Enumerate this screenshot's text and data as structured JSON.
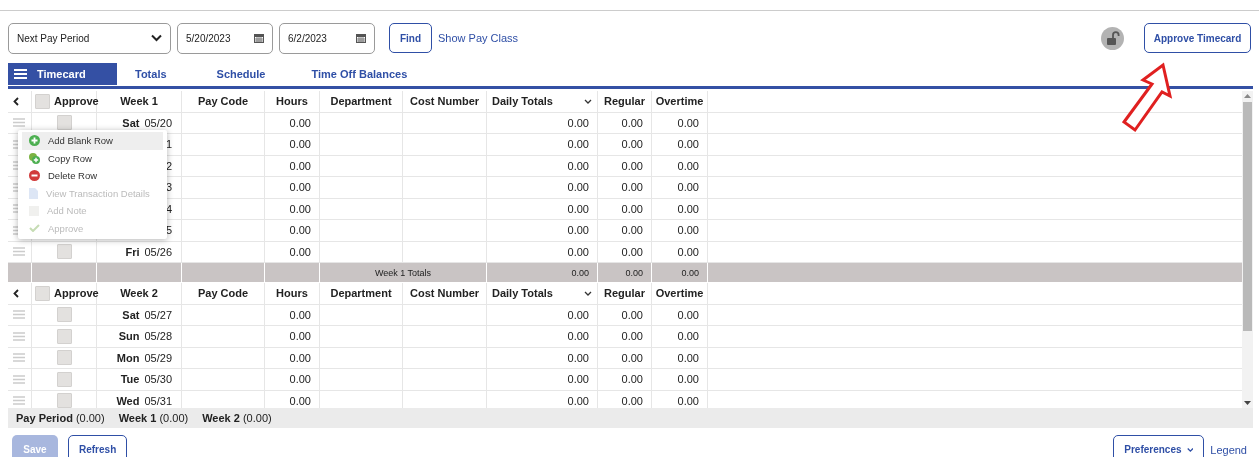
{
  "toolbar": {
    "period_select": "Next Pay Period",
    "start_date": "5/20/2023",
    "end_date": "6/2/2023",
    "find_button": "Find",
    "pay_class_link": "Show Pay Class",
    "locked": false,
    "approve_button": "Approve Timecard"
  },
  "tabs": [
    {
      "label": "Timecard",
      "selected": true
    },
    {
      "label": "Totals",
      "selected": false
    },
    {
      "label": "Schedule",
      "selected": false
    },
    {
      "label": "Time Off Balances",
      "selected": false
    }
  ],
  "weeks": [
    {
      "all_approved": false,
      "columns": [
        "Approve",
        "Week 1",
        "Pay Code",
        "Hours",
        "Department",
        "Cost Number",
        "Daily Totals",
        "Regular",
        "Overtime"
      ],
      "rows": [
        {
          "approved": false,
          "day": "Sat",
          "date": "05/20",
          "hours": "0.00",
          "daily_total": "0.00",
          "regular": "0.00",
          "overtime": "0.00"
        },
        {
          "date": "1",
          "hours": "0.00",
          "daily_total": "0.00",
          "regular": "0.00",
          "overtime": "0.00"
        },
        {
          "date": "2",
          "hours": "0.00",
          "daily_total": "0.00",
          "regular": "0.00",
          "overtime": "0.00"
        },
        {
          "date": "3",
          "hours": "0.00",
          "daily_total": "0.00",
          "regular": "0.00",
          "overtime": "0.00"
        },
        {
          "date": "4",
          "hours": "0.00",
          "daily_total": "0.00",
          "regular": "0.00",
          "overtime": "0.00"
        },
        {
          "date": "5",
          "hours": "0.00",
          "daily_total": "0.00",
          "regular": "0.00",
          "overtime": "0.00"
        },
        {
          "approved": false,
          "day": "Fri",
          "date": "05/26",
          "hours": "0.00",
          "daily_total": "0.00",
          "regular": "0.00",
          "overtime": "0.00"
        }
      ],
      "totals": {
        "label": "Week 1 Totals",
        "daily_total": "0.00",
        "regular": "0.00",
        "overtime": "0.00"
      }
    },
    {
      "all_approved": false,
      "columns": [
        "Approve",
        "Week 2",
        "Pay Code",
        "Hours",
        "Department",
        "Cost Number",
        "Daily Totals",
        "Regular",
        "Overtime"
      ],
      "rows": [
        {
          "approved": false,
          "day": "Sat",
          "date": "05/27",
          "hours": "0.00",
          "daily_total": "0.00",
          "regular": "0.00",
          "overtime": "0.00"
        },
        {
          "approved": false,
          "day": "Sun",
          "date": "05/28",
          "hours": "0.00",
          "daily_total": "0.00",
          "regular": "0.00",
          "overtime": "0.00"
        },
        {
          "approved": false,
          "day": "Mon",
          "date": "05/29",
          "hours": "0.00",
          "daily_total": "0.00",
          "regular": "0.00",
          "overtime": "0.00"
        },
        {
          "approved": false,
          "day": "Tue",
          "date": "05/30",
          "hours": "0.00",
          "daily_total": "0.00",
          "regular": "0.00",
          "overtime": "0.00"
        },
        {
          "approved": false,
          "day": "Wed",
          "date": "05/31",
          "hours": "0.00",
          "daily_total": "0.00",
          "regular": "0.00",
          "overtime": "0.00"
        }
      ]
    }
  ],
  "context_menu": [
    {
      "kind": "add",
      "label": "Add Blank Row",
      "disabled": false,
      "selected": true
    },
    {
      "kind": "copy",
      "label": "Copy Row",
      "disabled": false,
      "selected": false
    },
    {
      "kind": "delete",
      "label": "Delete Row",
      "disabled": false,
      "selected": false
    },
    {
      "kind": "document",
      "label": "View Transaction Details",
      "disabled": true,
      "selected": false
    },
    {
      "kind": "note",
      "label": "Add Note",
      "disabled": true,
      "selected": false
    },
    {
      "kind": "check",
      "label": "Approve",
      "disabled": true,
      "selected": false
    }
  ],
  "summary": [
    {
      "label": "Pay Period",
      "value": "(0.00)"
    },
    {
      "label": "Week 1",
      "value": "(0.00)"
    },
    {
      "label": "Week 2",
      "value": "(0.00)"
    }
  ],
  "footer": {
    "save_button": "Save",
    "save_disabled": true,
    "refresh_button": "Refresh",
    "preferences_button": "Preferences",
    "legend_link": "Legend"
  }
}
